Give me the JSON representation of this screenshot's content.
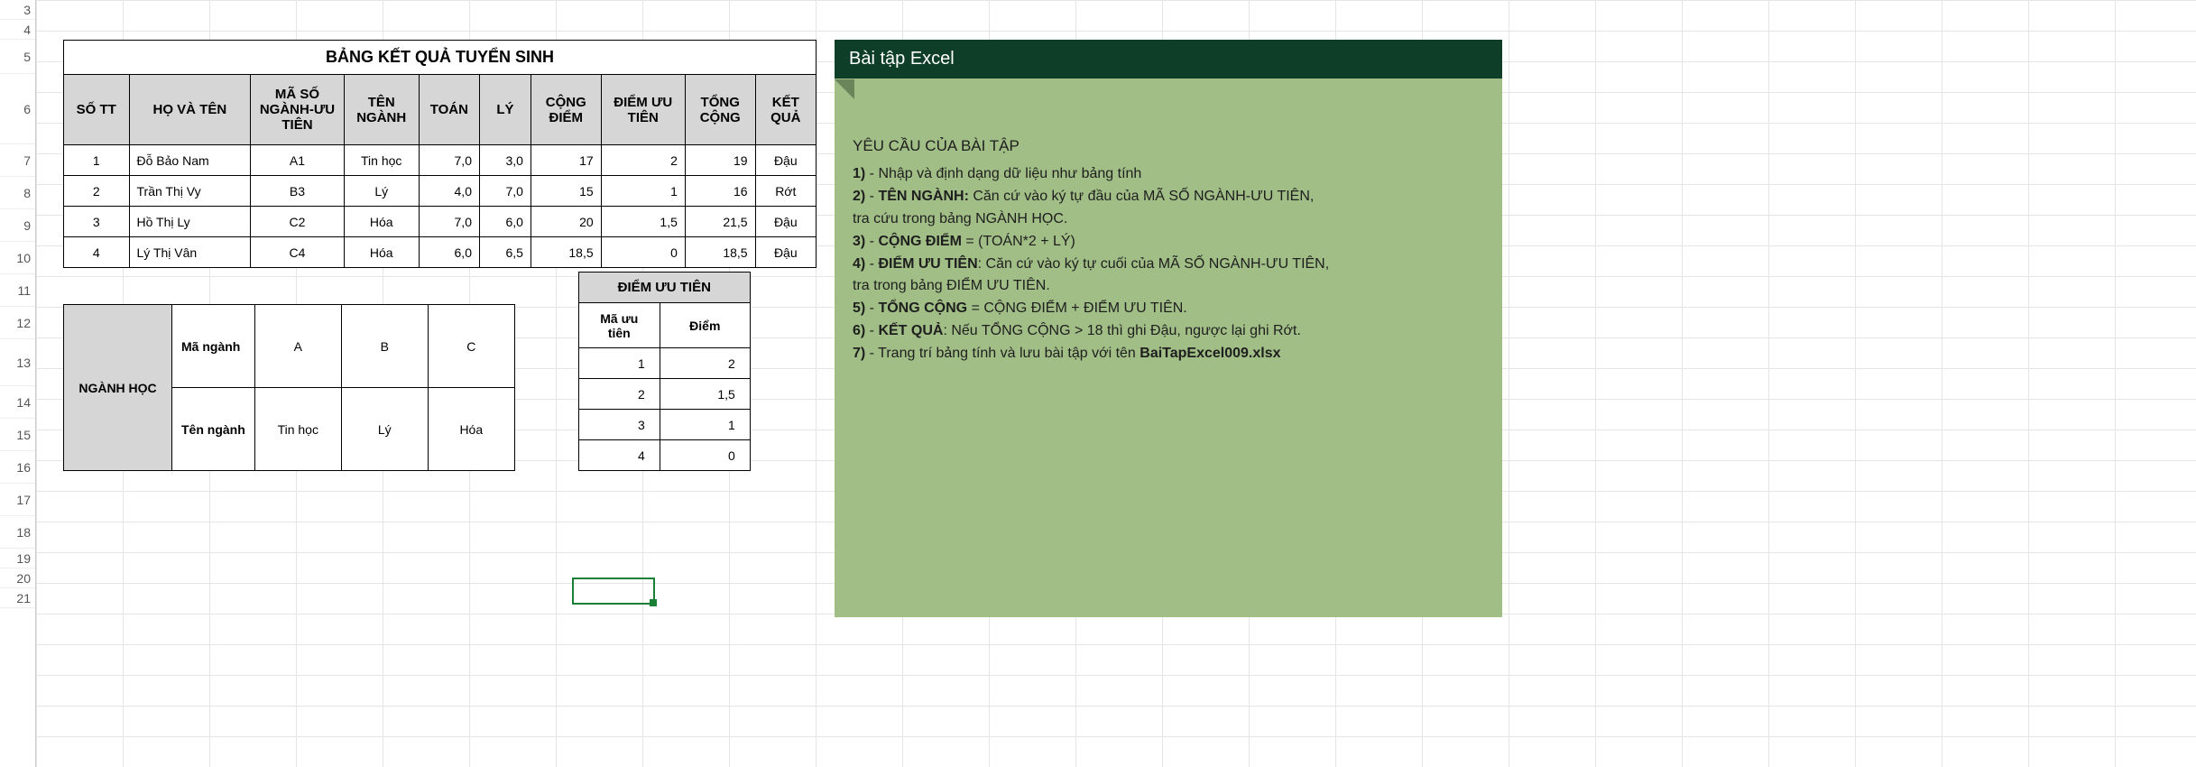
{
  "rowheads": [
    "3",
    "4",
    "5",
    "6",
    "7",
    "8",
    "9",
    "10",
    "11",
    "12",
    "13",
    "14",
    "15",
    "16",
    "17",
    "18",
    "19",
    "20",
    "21"
  ],
  "main": {
    "title": "BẢNG KẾT QUẢ TUYỂN SINH",
    "headers": [
      "SỐ TT",
      "HỌ VÀ TÊN",
      "MÃ SỐ NGÀNH-ƯU TIÊN",
      "TÊN NGÀNH",
      "TOÁN",
      "LÝ",
      "CỘNG ĐIỂM",
      "ĐIỂM ƯU TIÊN",
      "TỔNG CỘNG",
      "KẾT QUẢ"
    ],
    "rows": [
      {
        "tt": "1",
        "ten": "Đỗ Bảo Nam",
        "ma": "A1",
        "nganh": "Tin học",
        "toan": "7,0",
        "ly": "3,0",
        "cong": "17",
        "uu": "2",
        "tong": "19",
        "kq": "Đậu"
      },
      {
        "tt": "2",
        "ten": "Trần Thị Vy",
        "ma": "B3",
        "nganh": "Lý",
        "toan": "4,0",
        "ly": "7,0",
        "cong": "15",
        "uu": "1",
        "tong": "16",
        "kq": "Rớt"
      },
      {
        "tt": "3",
        "ten": "Hồ Thị Ly",
        "ma": "C2",
        "nganh": "Hóa",
        "toan": "7,0",
        "ly": "6,0",
        "cong": "20",
        "uu": "1,5",
        "tong": "21,5",
        "kq": "Đậu"
      },
      {
        "tt": "4",
        "ten": "Lý Thị Vân",
        "ma": "C4",
        "nganh": "Hóa",
        "toan": "6,0",
        "ly": "6,5",
        "cong": "18,5",
        "uu": "0",
        "tong": "18,5",
        "kq": "Đậu"
      }
    ]
  },
  "nganhHoc": {
    "sideLabel": "NGÀNH HỌC",
    "row1Label": "Mã ngành",
    "row2Label": "Tên ngành",
    "codes": [
      "A",
      "B",
      "C"
    ],
    "names": [
      "Tin học",
      "Lý",
      "Hóa"
    ]
  },
  "uuTien": {
    "title": "ĐIỂM ƯU TIÊN",
    "h1": "Mã ưu tiên",
    "h2": "Điểm",
    "rows": [
      {
        "ma": "1",
        "diem": "2"
      },
      {
        "ma": "2",
        "diem": "1,5"
      },
      {
        "ma": "3",
        "diem": "1"
      },
      {
        "ma": "4",
        "diem": "0"
      }
    ]
  },
  "panel": {
    "header": "Bài tập Excel",
    "reqTitle": "YÊU CẦU CỦA BÀI TẬP",
    "l1a": "1)",
    "l1b": " - Nhập và định dạng dữ liệu như bảng tính",
    "l2a": "2)",
    "l2b": " - ",
    "l2c": "TÊN NGÀNH:",
    "l2d": " Căn cứ vào ký tự đầu của MÃ SỐ NGÀNH-ƯU TIÊN,",
    "l2e": "tra cứu trong bảng NGÀNH HỌC.",
    "l3a": "3)",
    "l3b": " - ",
    "l3c": "CỘNG ĐIỂM",
    "l3d": " = (TOÁN*2 + LÝ)",
    "l4a": "4)",
    "l4b": " - ",
    "l4c": "ĐIỂM ƯU TIÊN",
    "l4d": ": Căn cứ vào ký tự cuối của MÃ SỐ NGÀNH-ƯU TIÊN,",
    "l4e": "tra trong bảng ĐIỂM ƯU TIÊN.",
    "l5a": "5)",
    "l5b": " - ",
    "l5c": "TỔNG CỘNG",
    "l5d": " = CỘNG ĐIỂM + ĐIỂM ƯU TIÊN.",
    "l6a": "6)",
    "l6b": " - ",
    "l6c": "KẾT QUẢ",
    "l6d": ": Nếu TỔNG CỘNG > 18 thì ghi Đậu, ngược lại ghi Rớt.",
    "l7a": "7)",
    "l7b": " - Trang trí bảng tính và lưu bài tập với tên ",
    "l7c": "BaiTapExcel009.xlsx"
  }
}
